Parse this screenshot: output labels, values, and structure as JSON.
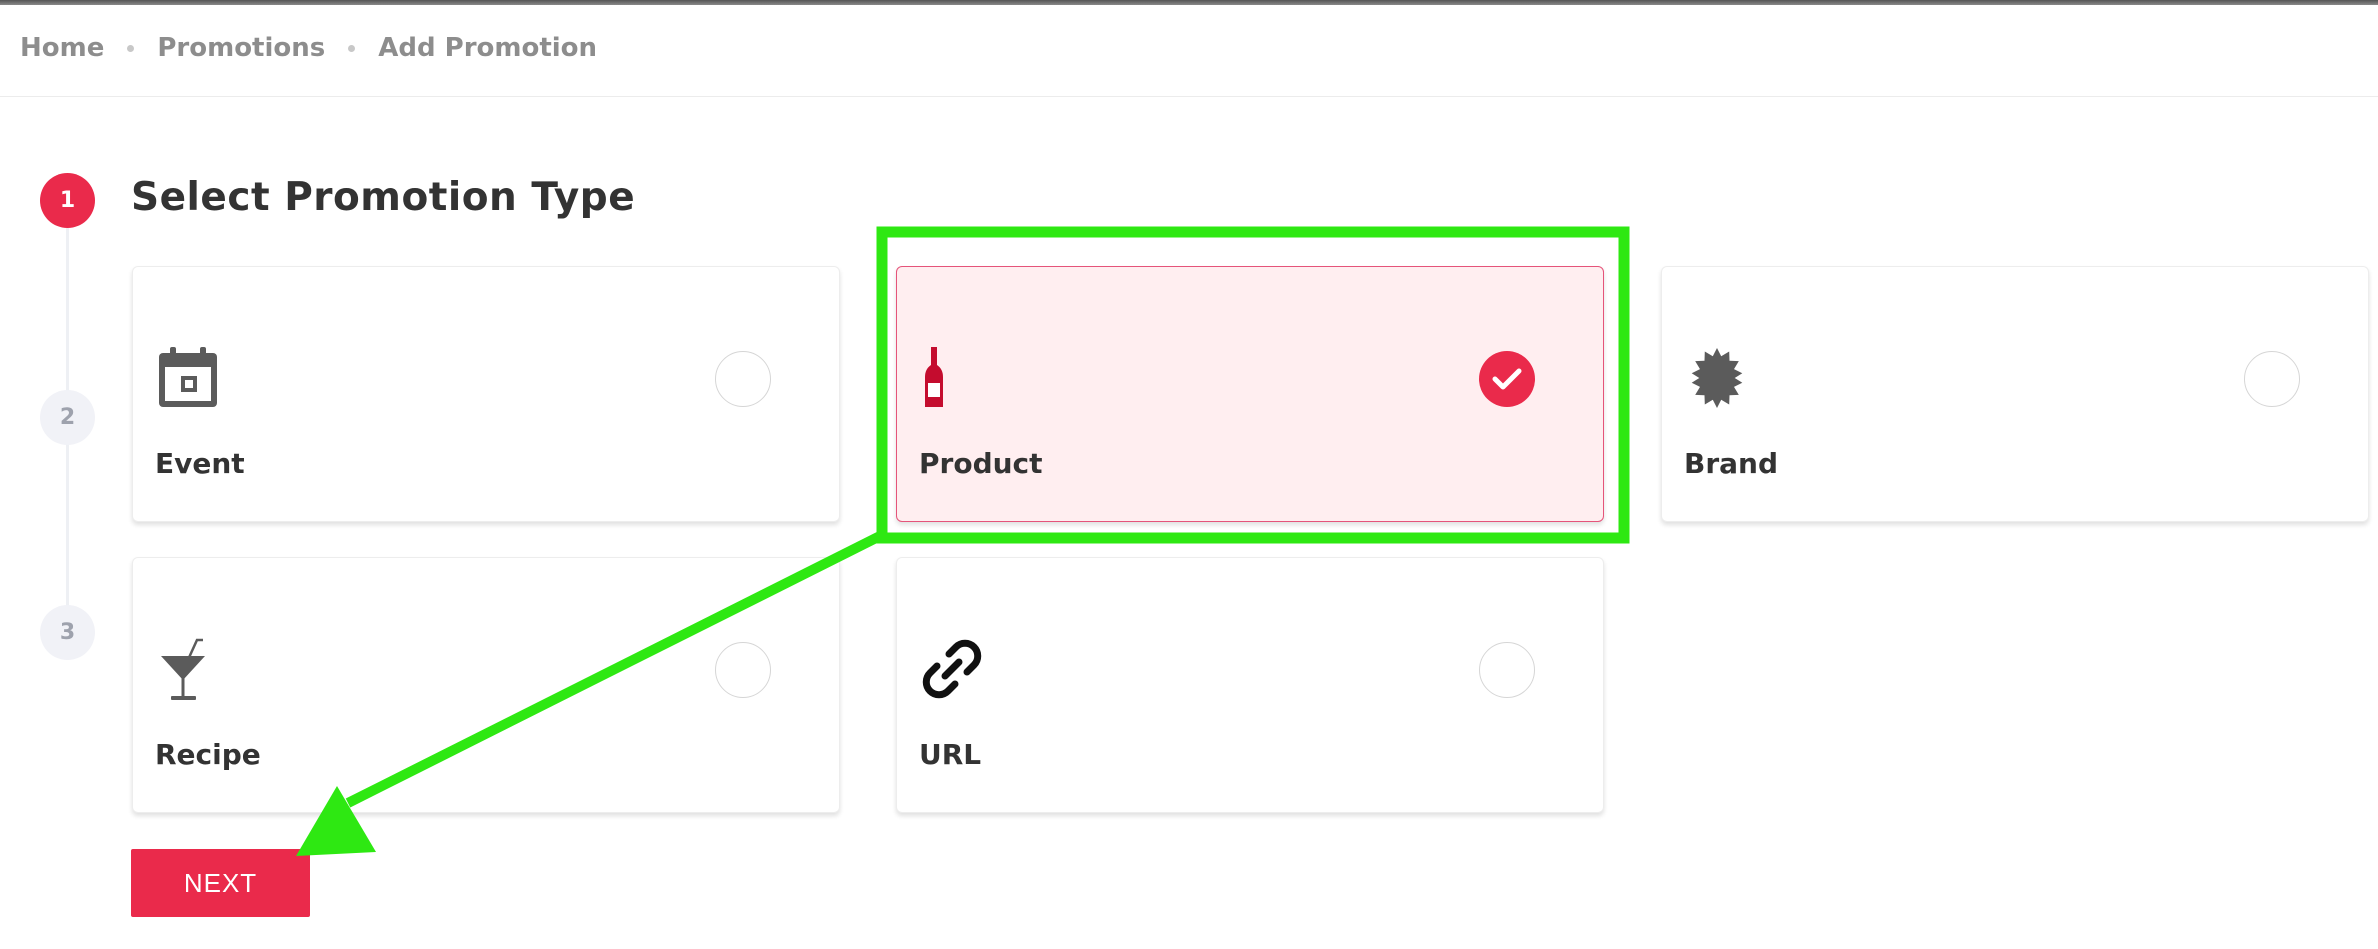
{
  "breadcrumb": {
    "items": [
      "Home",
      "Promotions",
      "Add Promotion"
    ]
  },
  "stepper": {
    "steps": [
      "1",
      "2",
      "3"
    ],
    "active_step": 1
  },
  "section": {
    "title": "Select Promotion Type"
  },
  "options": [
    {
      "label": "Event",
      "icon": "calendar-icon",
      "selected": false
    },
    {
      "label": "Product",
      "icon": "wine-bottle-icon",
      "selected": true
    },
    {
      "label": "Brand",
      "icon": "badge-icon",
      "selected": false
    },
    {
      "label": "Recipe",
      "icon": "cocktail-icon",
      "selected": false
    },
    {
      "label": "URL",
      "icon": "link-icon",
      "selected": false
    }
  ],
  "actions": {
    "next_label": "NEXT"
  },
  "colors": {
    "accent": "#ea2a4b",
    "selected_card_bg": "#ffeef0",
    "annotation_green": "#2ee812",
    "icon_gray": "#5b5b5b"
  }
}
